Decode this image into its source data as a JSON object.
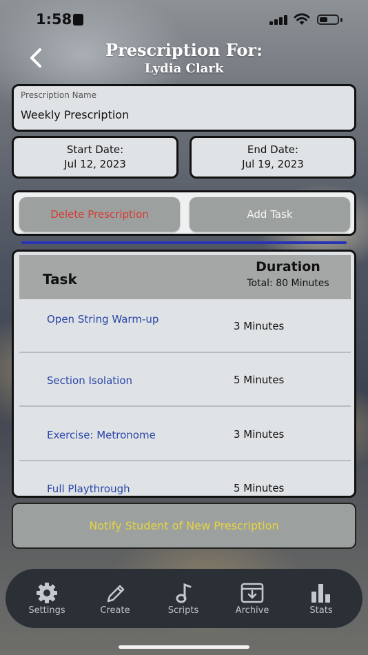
{
  "status_bar": {
    "time": "1:58"
  },
  "header": {
    "title": "Prescription For:",
    "student": "Lydia Clark"
  },
  "prescription_name": {
    "label": "Prescription Name",
    "value": "Weekly Prescription"
  },
  "start_date": {
    "label": "Start Date:",
    "value": "Jul 12, 2023"
  },
  "end_date": {
    "label": "End Date:",
    "value": "Jul 19, 2023"
  },
  "actions": {
    "delete_label": "Delete Prescription",
    "add_label": "Add Task"
  },
  "table": {
    "task_header": "Task",
    "duration_header": "Duration",
    "total": "Total: 80 Minutes",
    "rows": [
      {
        "task": "Open String Warm-up",
        "duration": "3 Minutes"
      },
      {
        "task": "Section Isolation",
        "duration": "5 Minutes"
      },
      {
        "task": "Exercise: Metronome",
        "duration": "3 Minutes"
      },
      {
        "task": "Full Playthrough",
        "duration": "5 Minutes"
      }
    ]
  },
  "notify_label": "Notify Student of New Prescription",
  "tabs": [
    {
      "label": "Settings",
      "icon": "gear-icon"
    },
    {
      "label": "Create",
      "icon": "pencil-icon"
    },
    {
      "label": "Scripts",
      "icon": "music-note-icon"
    },
    {
      "label": "Archive",
      "icon": "archive-box-icon"
    },
    {
      "label": "Stats",
      "icon": "bar-chart-icon"
    }
  ],
  "colors": {
    "delete_text": "#d63a33",
    "task_link": "#2b45a8",
    "notify_text": "#e6d43f",
    "divider_blue": "#2833b5",
    "tabbar_bg": "#2b2f36"
  }
}
